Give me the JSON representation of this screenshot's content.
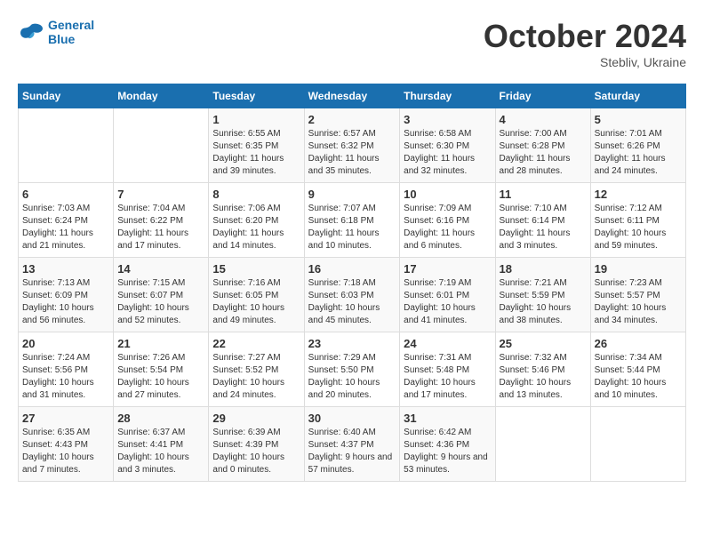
{
  "logo": {
    "text1": "General",
    "text2": "Blue"
  },
  "title": "October 2024",
  "subtitle": "Stebliv, Ukraine",
  "weekdays": [
    "Sunday",
    "Monday",
    "Tuesday",
    "Wednesday",
    "Thursday",
    "Friday",
    "Saturday"
  ],
  "weeks": [
    [
      {
        "day": "",
        "info": ""
      },
      {
        "day": "",
        "info": ""
      },
      {
        "day": "1",
        "info": "Sunrise: 6:55 AM\nSunset: 6:35 PM\nDaylight: 11 hours and 39 minutes."
      },
      {
        "day": "2",
        "info": "Sunrise: 6:57 AM\nSunset: 6:32 PM\nDaylight: 11 hours and 35 minutes."
      },
      {
        "day": "3",
        "info": "Sunrise: 6:58 AM\nSunset: 6:30 PM\nDaylight: 11 hours and 32 minutes."
      },
      {
        "day": "4",
        "info": "Sunrise: 7:00 AM\nSunset: 6:28 PM\nDaylight: 11 hours and 28 minutes."
      },
      {
        "day": "5",
        "info": "Sunrise: 7:01 AM\nSunset: 6:26 PM\nDaylight: 11 hours and 24 minutes."
      }
    ],
    [
      {
        "day": "6",
        "info": "Sunrise: 7:03 AM\nSunset: 6:24 PM\nDaylight: 11 hours and 21 minutes."
      },
      {
        "day": "7",
        "info": "Sunrise: 7:04 AM\nSunset: 6:22 PM\nDaylight: 11 hours and 17 minutes."
      },
      {
        "day": "8",
        "info": "Sunrise: 7:06 AM\nSunset: 6:20 PM\nDaylight: 11 hours and 14 minutes."
      },
      {
        "day": "9",
        "info": "Sunrise: 7:07 AM\nSunset: 6:18 PM\nDaylight: 11 hours and 10 minutes."
      },
      {
        "day": "10",
        "info": "Sunrise: 7:09 AM\nSunset: 6:16 PM\nDaylight: 11 hours and 6 minutes."
      },
      {
        "day": "11",
        "info": "Sunrise: 7:10 AM\nSunset: 6:14 PM\nDaylight: 11 hours and 3 minutes."
      },
      {
        "day": "12",
        "info": "Sunrise: 7:12 AM\nSunset: 6:11 PM\nDaylight: 10 hours and 59 minutes."
      }
    ],
    [
      {
        "day": "13",
        "info": "Sunrise: 7:13 AM\nSunset: 6:09 PM\nDaylight: 10 hours and 56 minutes."
      },
      {
        "day": "14",
        "info": "Sunrise: 7:15 AM\nSunset: 6:07 PM\nDaylight: 10 hours and 52 minutes."
      },
      {
        "day": "15",
        "info": "Sunrise: 7:16 AM\nSunset: 6:05 PM\nDaylight: 10 hours and 49 minutes."
      },
      {
        "day": "16",
        "info": "Sunrise: 7:18 AM\nSunset: 6:03 PM\nDaylight: 10 hours and 45 minutes."
      },
      {
        "day": "17",
        "info": "Sunrise: 7:19 AM\nSunset: 6:01 PM\nDaylight: 10 hours and 41 minutes."
      },
      {
        "day": "18",
        "info": "Sunrise: 7:21 AM\nSunset: 5:59 PM\nDaylight: 10 hours and 38 minutes."
      },
      {
        "day": "19",
        "info": "Sunrise: 7:23 AM\nSunset: 5:57 PM\nDaylight: 10 hours and 34 minutes."
      }
    ],
    [
      {
        "day": "20",
        "info": "Sunrise: 7:24 AM\nSunset: 5:56 PM\nDaylight: 10 hours and 31 minutes."
      },
      {
        "day": "21",
        "info": "Sunrise: 7:26 AM\nSunset: 5:54 PM\nDaylight: 10 hours and 27 minutes."
      },
      {
        "day": "22",
        "info": "Sunrise: 7:27 AM\nSunset: 5:52 PM\nDaylight: 10 hours and 24 minutes."
      },
      {
        "day": "23",
        "info": "Sunrise: 7:29 AM\nSunset: 5:50 PM\nDaylight: 10 hours and 20 minutes."
      },
      {
        "day": "24",
        "info": "Sunrise: 7:31 AM\nSunset: 5:48 PM\nDaylight: 10 hours and 17 minutes."
      },
      {
        "day": "25",
        "info": "Sunrise: 7:32 AM\nSunset: 5:46 PM\nDaylight: 10 hours and 13 minutes."
      },
      {
        "day": "26",
        "info": "Sunrise: 7:34 AM\nSunset: 5:44 PM\nDaylight: 10 hours and 10 minutes."
      }
    ],
    [
      {
        "day": "27",
        "info": "Sunrise: 6:35 AM\nSunset: 4:43 PM\nDaylight: 10 hours and 7 minutes."
      },
      {
        "day": "28",
        "info": "Sunrise: 6:37 AM\nSunset: 4:41 PM\nDaylight: 10 hours and 3 minutes."
      },
      {
        "day": "29",
        "info": "Sunrise: 6:39 AM\nSunset: 4:39 PM\nDaylight: 10 hours and 0 minutes."
      },
      {
        "day": "30",
        "info": "Sunrise: 6:40 AM\nSunset: 4:37 PM\nDaylight: 9 hours and 57 minutes."
      },
      {
        "day": "31",
        "info": "Sunrise: 6:42 AM\nSunset: 4:36 PM\nDaylight: 9 hours and 53 minutes."
      },
      {
        "day": "",
        "info": ""
      },
      {
        "day": "",
        "info": ""
      }
    ]
  ]
}
